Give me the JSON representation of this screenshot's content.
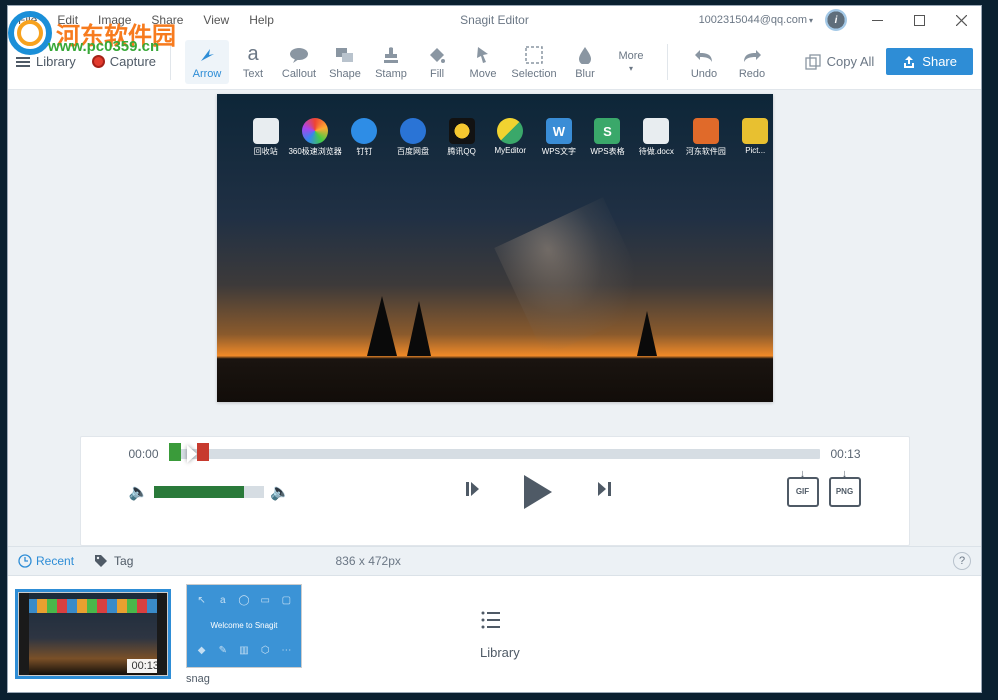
{
  "watermark": {
    "brand": "河东软件园",
    "url": "www.pc0359.cn"
  },
  "menubar": [
    "File",
    "Edit",
    "Image",
    "Share",
    "View",
    "Help"
  ],
  "title": "Snagit Editor",
  "account": "1002315044@qq.com",
  "toolbar": {
    "library": "Library",
    "capture": "Capture",
    "tools": [
      {
        "id": "arrow",
        "label": "Arrow",
        "selected": true
      },
      {
        "id": "text",
        "label": "Text"
      },
      {
        "id": "callout",
        "label": "Callout"
      },
      {
        "id": "shape",
        "label": "Shape"
      },
      {
        "id": "stamp",
        "label": "Stamp"
      },
      {
        "id": "fill",
        "label": "Fill"
      },
      {
        "id": "move",
        "label": "Move"
      },
      {
        "id": "selection",
        "label": "Selection"
      },
      {
        "id": "blur",
        "label": "Blur"
      }
    ],
    "more": "More",
    "undo": "Undo",
    "redo": "Redo",
    "copyall": "Copy All",
    "share": "Share"
  },
  "desktop_icons": [
    {
      "label": "回收站",
      "color": "#e8edf0"
    },
    {
      "label": "360极速浏览器",
      "color": "#3bce6a"
    },
    {
      "label": "钉钉",
      "color": "#2e8de6"
    },
    {
      "label": "百度网盘",
      "color": "#2a74d6"
    },
    {
      "label": "腾讯QQ",
      "color": "#121212"
    },
    {
      "label": "MyEditor",
      "color": "#f1d330"
    },
    {
      "label": "WPS文字",
      "color": "#3a8dd6"
    },
    {
      "label": "WPS表格",
      "color": "#3aa86a"
    },
    {
      "label": "待做.docx",
      "color": "#e8edf0"
    },
    {
      "label": "河东软件园",
      "color": "#e06a2a"
    },
    {
      "label": "Pict...",
      "color": "#e8c030"
    }
  ],
  "player": {
    "current": "00:00",
    "duration": "00:13",
    "export_gif": "GIF",
    "export_png": "PNG"
  },
  "traybar": {
    "recent": "Recent",
    "tag": "Tag",
    "dims": "836 x 472px",
    "help": "?"
  },
  "tray": {
    "thumb1_duration": "00:13",
    "thumb2_caption": "snag",
    "library": "Library"
  }
}
